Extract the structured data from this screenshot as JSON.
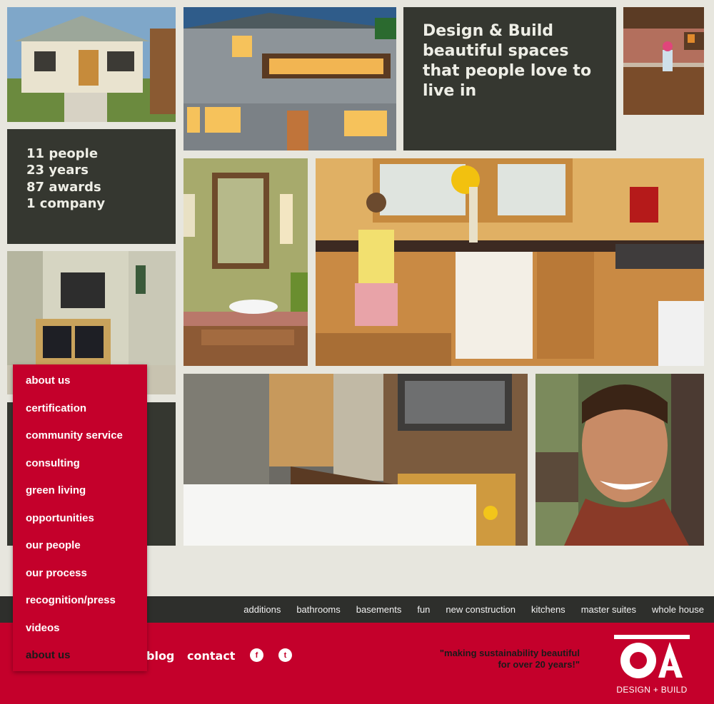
{
  "tagline": "Design & Build beautiful spaces that people love to live in",
  "stats": [
    "11 people",
    "23 years",
    "87 awards",
    "1 company"
  ],
  "photos": [
    {
      "name": "photo-cottage-exterior"
    },
    {
      "name": "photo-house-evening"
    },
    {
      "name": "photo-kitchen-shelves"
    },
    {
      "name": "photo-living-room-tv"
    },
    {
      "name": "photo-bathroom-vanity"
    },
    {
      "name": "photo-kitchen-girl"
    },
    {
      "name": "photo-bedroom"
    },
    {
      "name": "photo-smiling-man"
    }
  ],
  "menu": {
    "items": [
      "about us",
      "certification",
      "community service",
      "consulting",
      "green living",
      "opportunities",
      "our people",
      "our process",
      "recognition/press",
      "videos"
    ],
    "current": "about us"
  },
  "categories": [
    "additions",
    "bathrooms",
    "basements",
    "fun",
    "new construction",
    "kitchens",
    "master suites",
    "whole house"
  ],
  "footer": {
    "links": [
      "blog",
      "contact"
    ],
    "social": [
      {
        "icon": "facebook-icon",
        "glyph": "f"
      },
      {
        "icon": "twitter-icon",
        "glyph": "t"
      }
    ],
    "quote_line1": "\"making sustainability beautiful",
    "quote_line2": "for over 20 years!\"",
    "logo_text": "DESIGN + BUILD"
  },
  "colors": {
    "brand_red": "#c4002b",
    "dark_panel": "#353730",
    "background": "#e7e6de"
  }
}
